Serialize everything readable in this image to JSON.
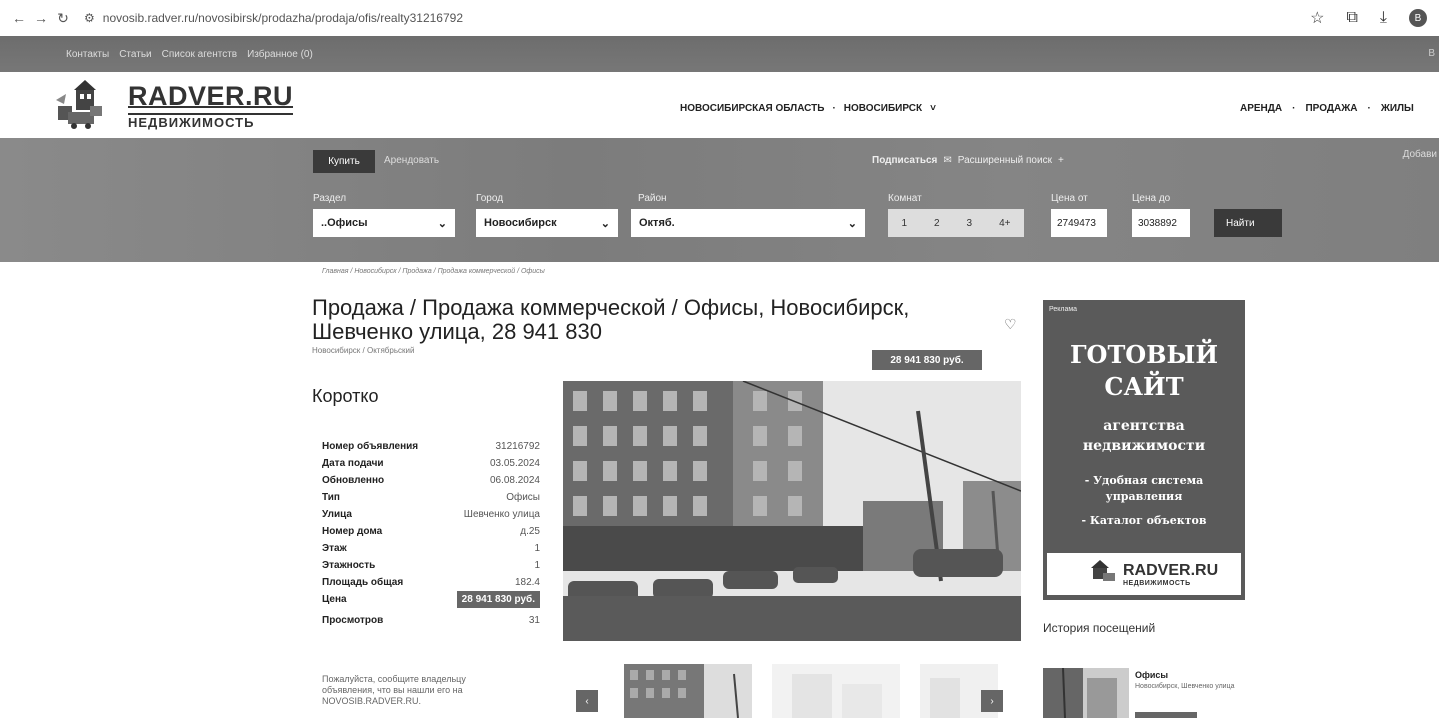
{
  "browser": {
    "url": "novosib.radver.ru/novosibirsk/prodazha/prodaja/ofis/realty31216792",
    "profile_initial": "В"
  },
  "topbar": {
    "links": [
      "Контакты",
      "Статьи",
      "Список агентств",
      "Избранное (0)"
    ],
    "edge_text": "В"
  },
  "header": {
    "logo_big": "RADVER.RU",
    "logo_small": "НЕДВИЖИМОСТЬ",
    "region": [
      "НОВОСИБИРСКАЯ ОБЛАСТЬ",
      "НОВОСИБИРСК"
    ],
    "nav": [
      "АРЕНДА",
      "ПРОДАЖА",
      "ЖИЛЫ"
    ]
  },
  "search": {
    "tab_buy": "Купить",
    "tab_rent": "Арендовать",
    "subscribe": "Подписаться",
    "advanced": "Расширенный поиск",
    "add_link": "Добави",
    "section_label": "Раздел",
    "section_value": "..Офисы",
    "city_label": "Город",
    "city_value": "Новосибирск",
    "district_label": "Район",
    "district_value": "Октяб.",
    "rooms_label": "Комнат",
    "rooms": [
      "1",
      "2",
      "3",
      "4+"
    ],
    "price_from_label": "Цена от",
    "price_from_value": "2749473",
    "price_to_label": "Цена до",
    "price_to_value": "3038892",
    "find_button": "Найти"
  },
  "listing": {
    "breadcrumb": "Главная / Новосибирск / Продажа / Продажа коммерческой / Офисы",
    "title": "Продажа / Продажа коммерческой / Офисы, Новосибирск, Шевченко улица, 28 941 830",
    "location": "Новосибирск / Октябрьский",
    "price_badge": "28 941 830 руб.",
    "short_title": "Коротко",
    "properties": [
      {
        "k": "Номер объявления",
        "v": "31216792"
      },
      {
        "k": "Дата подачи",
        "v": "03.05.2024"
      },
      {
        "k": "Обновленно",
        "v": "06.08.2024"
      },
      {
        "k": "Тип",
        "v": "Офисы"
      },
      {
        "k": "Улица",
        "v": "Шевченко улица"
      },
      {
        "k": "Номер дома",
        "v": "д.25"
      },
      {
        "k": "Этаж",
        "v": "1"
      },
      {
        "k": "Этажность",
        "v": "1"
      },
      {
        "k": "Площадь общая",
        "v": "182.4"
      },
      {
        "k": "Цена",
        "v": "28 941 830 руб."
      },
      {
        "k": "Просмотров",
        "v": "31"
      }
    ],
    "note": "Пожалуйста, сообщите владельцу объявления, что вы нашли его на NOVOSIB.RADVER.RU."
  },
  "ad": {
    "label": "Реклама",
    "lines": [
      "ГОТОВЫЙ",
      "САЙТ",
      "агентства",
      "недвижимости",
      "- Удобная система",
      "управления",
      "- Каталог объектов"
    ],
    "logo_big": "RADVER.RU",
    "logo_small": "НЕДВИЖИМОСТЬ"
  },
  "history": {
    "title": "История посещений",
    "item_title": "Офисы",
    "item_sub": "Новосибирск, Шевченко улица"
  }
}
